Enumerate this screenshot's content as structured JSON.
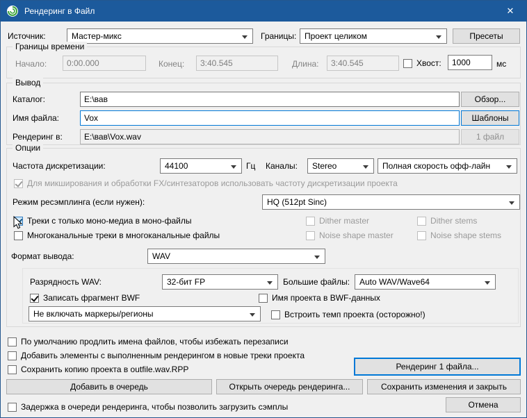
{
  "window": {
    "title": "Рендеринг в Файл",
    "close_glyph": "✕"
  },
  "top": {
    "source_label": "Источник:",
    "source_value": "Мастер-микс",
    "bounds_label": "Границы:",
    "bounds_value": "Проект целиком",
    "presets_button": "Пресеты"
  },
  "time": {
    "group_title": "Границы времени",
    "start_label": "Начало:",
    "start_value": "0:00.000",
    "end_label": "Конец:",
    "end_value": "3:40.545",
    "length_label": "Длина:",
    "length_value": "3:40.545",
    "tail_label": "Хвост:",
    "tail_value": "1000",
    "tail_unit": "мс"
  },
  "output": {
    "group_title": "Вывод",
    "directory_label": "Каталог:",
    "directory_value": "E:\\вав",
    "browse_button": "Обзор...",
    "filename_label": "Имя файла:",
    "filename_value": "Vox",
    "templates_button": "Шаблоны",
    "render_to_label": "Рендеринг в:",
    "render_to_value": "E:\\вав\\Vox.wav",
    "file_count_button": "1 файл"
  },
  "options": {
    "group_title": "Опции",
    "samplerate_label": "Частота дискретизации:",
    "samplerate_value": "44100",
    "hz_unit": "Гц",
    "channels_label": "Каналы:",
    "channels_value": "Stereo",
    "speed_value": "Полная скорость офф-лайн",
    "project_sr_checkbox": "Для микширования и обработки FX/синтезаторов использовать частоту дискретизации проекта",
    "resample_label": "Режим ресэмплинга (если нужен):",
    "resample_value": "HQ (512pt Sinc)",
    "mono_checkbox": "Треки с только моно-медиа в моно-файлы",
    "multichannel_checkbox": "Многоканальные треки в многоканальные файлы",
    "dither_master": "Dither master",
    "dither_stems": "Dither stems",
    "noise_shape_master": "Noise shape master",
    "noise_shape_stems": "Noise shape stems",
    "format_label": "Формат вывода:",
    "format_value": "WAV"
  },
  "wav": {
    "depth_label": "Разрядность WAV:",
    "depth_value": "32-бит FP",
    "large_files_label": "Большие файлы:",
    "large_files_value": "Auto WAV/Wave64",
    "bwf_checkbox": "Записать фрагмент BWF",
    "project_name_checkbox": "Имя проекта в BWF-данных",
    "markers_value": "Не включать маркеры/регионы",
    "embed_tempo_checkbox": "Встроить темп проекта (осторожно!)"
  },
  "bottom": {
    "autoextend_checkbox": "По умолчанию продлить имена файлов, чтобы избежать перезаписи",
    "add_items_checkbox": "Добавить элементы с выполненным рендерингом в новые треки проекта",
    "save_copy_checkbox": "Сохранить копию проекта в outfile.wav.RPP",
    "render_button": "Рендеринг 1 файла...",
    "queue_add_button": "Добавить в очередь",
    "queue_open_button": "Открыть очередь рендеринга...",
    "save_close_button": "Сохранить изменения и закрыть",
    "delay_checkbox": "Задержка в очереди рендеринга, чтобы позволить загрузить сэмплы",
    "cancel_button": "Отмена"
  }
}
